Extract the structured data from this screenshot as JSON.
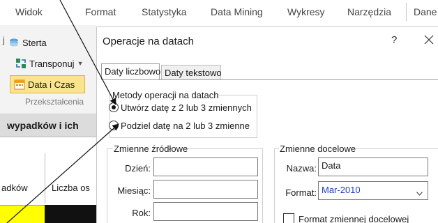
{
  "menubar": {
    "items": [
      "Widok",
      "Format",
      "Statystyka",
      "Data Mining",
      "Wykresy",
      "Narzędzia",
      "Dane"
    ]
  },
  "ribbon": {
    "buttons": {
      "sterta": "Sterta",
      "transponuj": "Transponuj",
      "data_czas": "Data i Czas"
    },
    "group_label": "Przekształcenia"
  },
  "sheet": {
    "title": "wypadków i ich",
    "col1_header": "adków",
    "col2_header": "Liczba os"
  },
  "dialog": {
    "title": "Operacje na datach",
    "help": "?",
    "tabs": [
      "Daty liczbowo",
      "Daty tekstowo"
    ],
    "methods": {
      "legend": "Metody operacji na datach",
      "options": [
        {
          "label": "Utwórz datę z 2 lub 3 zmiennych",
          "checked": true
        },
        {
          "label": "Podziel datę na 2 lub 3 zmienne",
          "checked": false
        }
      ]
    },
    "source": {
      "legend": "Zmienne źródłowe",
      "day_label": "Dzień:",
      "month_label": "Miesiąc:",
      "year_label": "Rok:",
      "day_value": "",
      "month_value": "",
      "year_value": ""
    },
    "target": {
      "legend": "Zmienne docelowe",
      "name_label": "Nazwa:",
      "name_value": "Data",
      "format_label": "Format:",
      "format_value": "Mar-2010",
      "checkbox_label": "Format zmiennej docelowej",
      "checkbox_checked": false
    }
  },
  "colors": {
    "accent_yellow": "#fbe48e",
    "cell_yellow": "#ffff00",
    "format_value_blue": "#1f3fbf"
  }
}
